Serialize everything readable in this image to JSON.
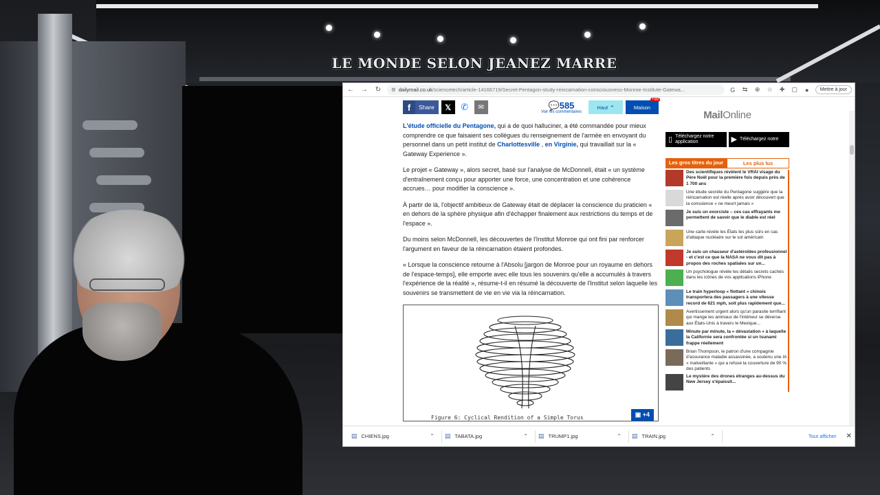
{
  "overlay": {
    "banner_title": "LE MONDE SELON JEANEZ MARRE"
  },
  "browser": {
    "url_domain": "dailymail.co.uk",
    "url_path": "/sciencetech/article-14166719/Secret-Pentagon-study-reincarnation-consciousness-Monroe-Institute-Gatewa...",
    "update_button": "Mettre à jour"
  },
  "article": {
    "share_label": "Share",
    "comment_count": "585",
    "comment_label": "Voir les commentaires",
    "haut_label": "Haut",
    "maison_label": "Maison",
    "maison_badge": "+99",
    "paragraphs": [
      {
        "link1": "L'étude officielle du Pentagone,",
        "text1": " qui a de quoi halluciner, a été commandée pour mieux comprendre ce que faisaient ses collègues du renseignement de l'armée en envoyant du personnel dans un petit institut de ",
        "link2": "Charlottesville",
        "text2": " , ",
        "link3": "en Virginie,",
        "text3": " qui travaillait sur la « Gateway Experience »."
      },
      {
        "text": "Le projet « Gateway », alors secret, basé sur l'analyse de McDonnell, était « un système d'entraînement conçu pour apporter une force, une concentration et une cohérence accrues… pour modifier la conscience »."
      },
      {
        "text": "À partir de là, l'objectif ambitieux de Gateway était de déplacer la conscience du praticien « en dehors de la sphère physique afin d'échapper finalement aux restrictions du temps et de l'espace »."
      },
      {
        "text": "Du moins selon McDonnell, les découvertes de l'Institut Monroe qui ont fini par renforcer l'argument en faveur de la réincarnation étaient profondes."
      },
      {
        "text": "« Lorsque la conscience retourne à l'Absolu [jargon de Monroe pour un royaume en dehors de l'espace-temps], elle emporte avec elle tous les souvenirs qu'elle a accumulés à travers l'expérience de la réalité », résume-t-il en résumé la découverte de l'Institut selon laquelle les souvenirs se transmettent de vie en vie via la réincarnation."
      }
    ],
    "figure_caption": "Figure 6: Cyclical Rendition of a Simple Torus",
    "gallery_count": "+4"
  },
  "sidebar": {
    "logo_mail": "Mail",
    "logo_online": "Online",
    "store1": "Téléchargez notre application",
    "store2": "Téléchargez notre",
    "tab_active": "Les gros titres du jour",
    "tab_inactive": "Les plus lus",
    "news": [
      {
        "text": "Des scientifiques révèlent le VRAI visage du Père Noël pour la première fois depuis près de 1 700 ans",
        "bold": true,
        "color": "#b33a2a"
      },
      {
        "text": "Une étude secrète du Pentagone suggère que la réincarnation est réelle après avoir découvert que la conscience « ne meurt jamais »",
        "bold": false,
        "color": "#d9d9d9"
      },
      {
        "text": "Je suis un exorciste – ces cas effrayants me permettent de savoir que le diable est réel",
        "bold": true,
        "color": "#6b6b6b"
      },
      {
        "text": "Une carte révèle les États les plus sûrs en cas d'attaque nucléaire sur le sol américain",
        "bold": false,
        "color": "#c9a55c"
      },
      {
        "text": "Je suis un chasseur d'astéroïdes professionnel - et c'est ce que la NASA ne vous dit pas à propos des roches spatiales sur un...",
        "bold": true,
        "color": "#c0392b"
      },
      {
        "text": "Un psychologue révèle les détails secrets cachés dans les icônes de vos applications iPhone",
        "bold": false,
        "color": "#4caf50"
      },
      {
        "text": "Le train hyperloop « flottant » chinois transportera des passagers à une vitesse record de 621 mph, soit plus rapidement que...",
        "bold": true,
        "color": "#5d8fb8"
      },
      {
        "text": "Avertissement urgent alors qu'un parasite terrifiant qui mange les animaux de l'intérieur se déverse aux États-Unis à travers le Mexique...",
        "bold": false,
        "color": "#b08a4a"
      },
      {
        "text": "Minute par minute, la « dévastation » à laquelle la Californie sera confrontée si un tsunami frappe réellement",
        "bold": true,
        "color": "#3a6d99"
      },
      {
        "text": "Brian Thompson, le patron d'une compagnie d'assurance maladie assassinée, a soutenu une IA « malveillante » qui a refusé la couverture de 90 % des patients",
        "bold": false,
        "color": "#7a6a5a"
      },
      {
        "text": "Le mystère des drones étranges au-dessus du New Jersey s'épaissit...",
        "bold": true,
        "color": "#444444"
      }
    ]
  },
  "downloads": {
    "files": [
      "CHIENS.jpg",
      "TABATA.jpg",
      "TRUMP1.jpg",
      "TRAIN.jpg"
    ],
    "show_all": "Tout afficher"
  },
  "colors": {
    "accent_orange": "#e6610c",
    "link_blue": "#004db3",
    "facebook": "#3b5998"
  }
}
